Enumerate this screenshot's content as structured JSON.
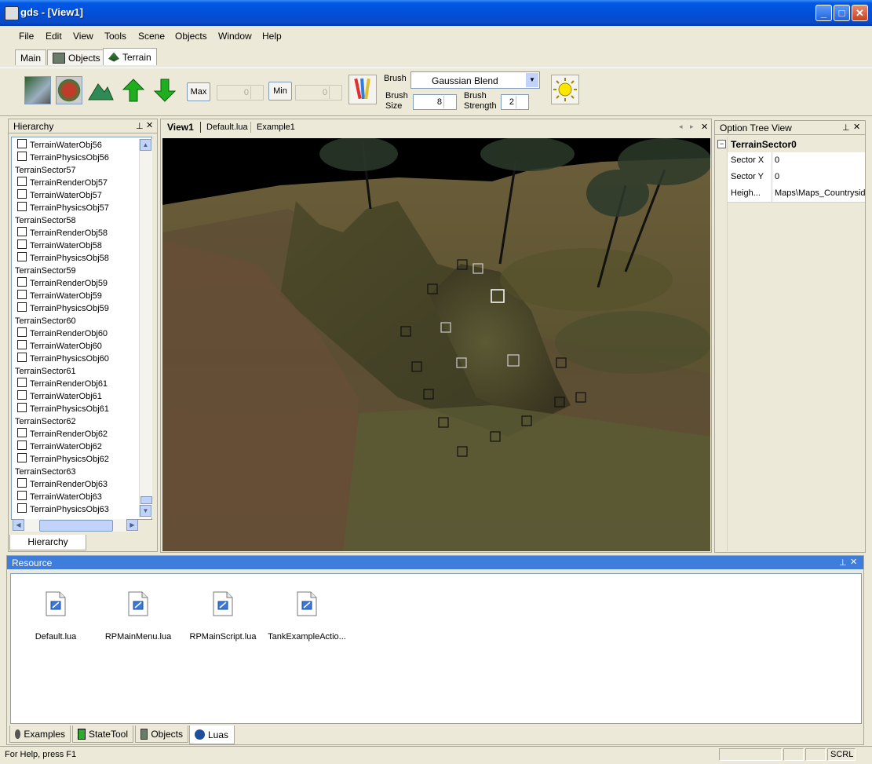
{
  "window": {
    "title": "gds - [View1]"
  },
  "menu": [
    "File",
    "Edit",
    "View",
    "Tools",
    "Scene",
    "Objects",
    "Window",
    "Help"
  ],
  "top_tabs": [
    {
      "label": "Main",
      "active": false
    },
    {
      "label": "Objects",
      "active": false
    },
    {
      "label": "Terrain",
      "active": true
    }
  ],
  "toolbar": {
    "max_label": "Max",
    "max_value": "0",
    "min_label": "Min",
    "min_value": "0",
    "brush_label": "Brush",
    "brush_value": "Gaussian Blend",
    "brush_size_label_1": "Brush",
    "brush_size_label_2": "Size",
    "brush_size_value": "8",
    "brush_strength_label_1": "Brush",
    "brush_strength_label_2": "Strength",
    "brush_strength_value": "2"
  },
  "hierarchy": {
    "title": "Hierarchy",
    "tab_label": "Hierarchy",
    "rows": [
      {
        "label": "TerrainWaterObj56",
        "type": "obj"
      },
      {
        "label": "TerrainPhysicsObj56",
        "type": "obj"
      },
      {
        "label": "TerrainSector57",
        "type": "sector"
      },
      {
        "label": "TerrainRenderObj57",
        "type": "obj"
      },
      {
        "label": "TerrainWaterObj57",
        "type": "obj"
      },
      {
        "label": "TerrainPhysicsObj57",
        "type": "obj"
      },
      {
        "label": "TerrainSector58",
        "type": "sector"
      },
      {
        "label": "TerrainRenderObj58",
        "type": "obj"
      },
      {
        "label": "TerrainWaterObj58",
        "type": "obj"
      },
      {
        "label": "TerrainPhysicsObj58",
        "type": "obj"
      },
      {
        "label": "TerrainSector59",
        "type": "sector"
      },
      {
        "label": "TerrainRenderObj59",
        "type": "obj"
      },
      {
        "label": "TerrainWaterObj59",
        "type": "obj"
      },
      {
        "label": "TerrainPhysicsObj59",
        "type": "obj"
      },
      {
        "label": "TerrainSector60",
        "type": "sector"
      },
      {
        "label": "TerrainRenderObj60",
        "type": "obj"
      },
      {
        "label": "TerrainWaterObj60",
        "type": "obj"
      },
      {
        "label": "TerrainPhysicsObj60",
        "type": "obj"
      },
      {
        "label": "TerrainSector61",
        "type": "sector"
      },
      {
        "label": "TerrainRenderObj61",
        "type": "obj"
      },
      {
        "label": "TerrainWaterObj61",
        "type": "obj"
      },
      {
        "label": "TerrainPhysicsObj61",
        "type": "obj"
      },
      {
        "label": "TerrainSector62",
        "type": "sector"
      },
      {
        "label": "TerrainRenderObj62",
        "type": "obj"
      },
      {
        "label": "TerrainWaterObj62",
        "type": "obj"
      },
      {
        "label": "TerrainPhysicsObj62",
        "type": "obj"
      },
      {
        "label": "TerrainSector63",
        "type": "sector"
      },
      {
        "label": "TerrainRenderObj63",
        "type": "obj"
      },
      {
        "label": "TerrainWaterObj63",
        "type": "obj"
      },
      {
        "label": "TerrainPhysicsObj63",
        "type": "obj"
      }
    ]
  },
  "doc_tabs": [
    "View1",
    "Default.lua",
    "Example1"
  ],
  "option_tree": {
    "title": "Option Tree View",
    "root": "TerrainSector0",
    "rows": [
      {
        "key": "Sector X",
        "value": "0"
      },
      {
        "key": "Sector Y",
        "value": "0"
      },
      {
        "key": "Heigh...",
        "value": "Maps\\Maps_Countryside"
      }
    ]
  },
  "resource": {
    "title": "Resource",
    "files": [
      "Default.lua",
      "RPMainMenu.lua",
      "RPMainScript.lua",
      "TankExampleActio..."
    ]
  },
  "bottom_tabs": [
    {
      "label": "Examples",
      "active": false
    },
    {
      "label": "StateTool",
      "active": false
    },
    {
      "label": "Objects",
      "active": false
    },
    {
      "label": "Luas",
      "active": true
    }
  ],
  "status": {
    "text": "For Help, press F1",
    "scrl": "SCRL"
  },
  "colors": {
    "titlebar": "#0058e6",
    "panel_active": "#3e7ddc",
    "face": "#ece9d8"
  },
  "icons": [
    "app-icon",
    "minimize-icon",
    "maximize-icon",
    "close-icon",
    "terrain-icon",
    "objects-icon",
    "raise-icon",
    "lower-icon",
    "paint-brush-icon",
    "sun-icon",
    "lua-file-icon"
  ]
}
